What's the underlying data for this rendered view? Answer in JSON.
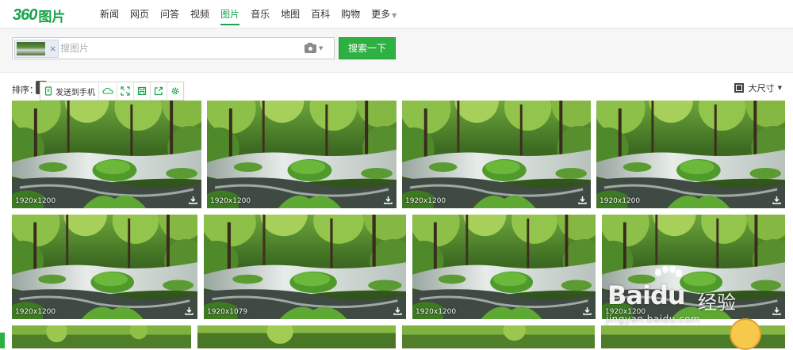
{
  "header": {
    "logo_num": "360",
    "logo_text": "图片",
    "nav": [
      {
        "label": "新闻",
        "active": false
      },
      {
        "label": "网页",
        "active": false
      },
      {
        "label": "问答",
        "active": false
      },
      {
        "label": "视频",
        "active": false
      },
      {
        "label": "图片",
        "active": true
      },
      {
        "label": "音乐",
        "active": false
      },
      {
        "label": "地图",
        "active": false
      },
      {
        "label": "百科",
        "active": false
      },
      {
        "label": "购物",
        "active": false
      },
      {
        "label": "更多",
        "active": false,
        "dropdown": true
      }
    ]
  },
  "search": {
    "placeholder": "搜图片",
    "value": "",
    "thumb_chip_close": "×",
    "button_label": "搜索一下",
    "camera_icon": "camera-icon"
  },
  "toolbar": {
    "sort_label": "排序：",
    "tools": [
      {
        "name": "send-to-phone",
        "icon": "phone-icon",
        "label": "发送到手机"
      },
      {
        "name": "cloud",
        "icon": "cloud-icon",
        "label": ""
      },
      {
        "name": "fullscreen",
        "icon": "expand-icon",
        "label": ""
      },
      {
        "name": "save",
        "icon": "save-icon",
        "label": ""
      },
      {
        "name": "share",
        "icon": "share-icon",
        "label": ""
      },
      {
        "name": "settings",
        "icon": "gear-icon",
        "label": ""
      }
    ],
    "size_filter_label": "大尺寸"
  },
  "results": [
    {
      "dims": "1920x1200"
    },
    {
      "dims": "1920x1200"
    },
    {
      "dims": "1920x1200"
    },
    {
      "dims": "1920x1200"
    },
    {
      "dims": "1920x1200"
    },
    {
      "dims": "1920x1079"
    },
    {
      "dims": "1920x1200"
    },
    {
      "dims": "1920x1200"
    },
    {
      "dims": ""
    },
    {
      "dims": ""
    },
    {
      "dims": ""
    },
    {
      "dims": ""
    }
  ],
  "watermark": {
    "brand": "Bai",
    "brand2": "du",
    "product": "经验",
    "url": "jingyan.baidu.com"
  },
  "colors": {
    "accent": "#2fb043",
    "logo": "#19a34a"
  }
}
